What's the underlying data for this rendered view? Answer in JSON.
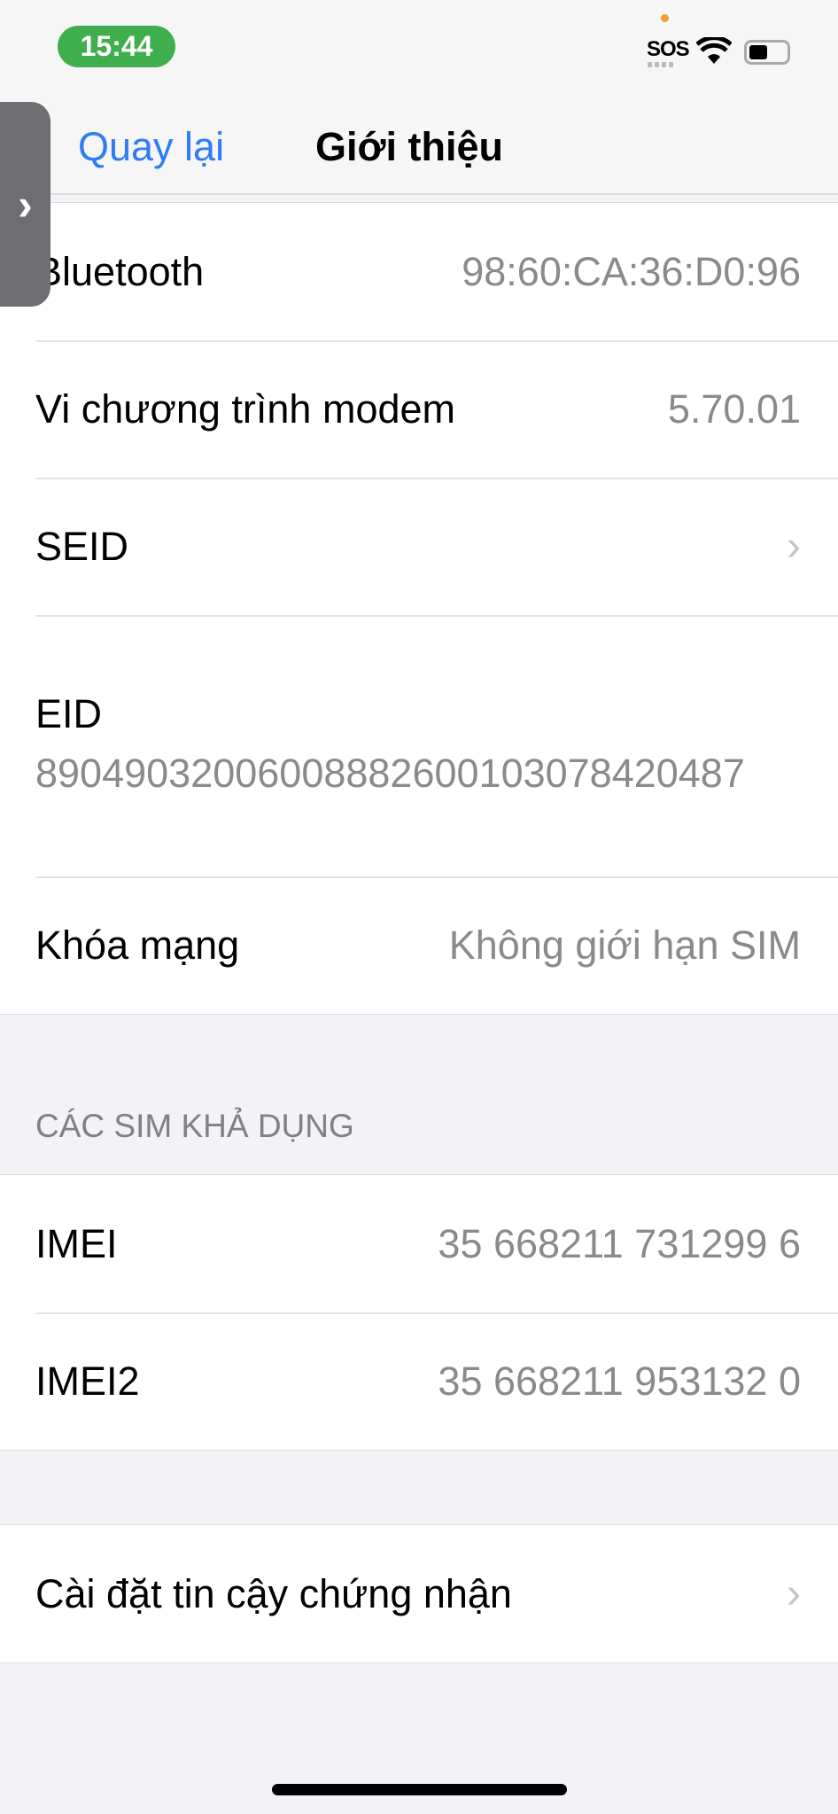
{
  "status_bar": {
    "time": "15:44",
    "carrier": "SOS",
    "wifi_icon": "wifi-icon",
    "battery_icon": "battery-icon"
  },
  "nav": {
    "back_label": "Quay lại",
    "title": "Giới thiệu"
  },
  "overlay_tab_icon": "chevron-right-icon",
  "rows": [
    {
      "label": "Bluetooth",
      "value": "98:60:CA:36:D0:96"
    },
    {
      "label": "Vi chương trình modem",
      "value": "5.70.01"
    },
    {
      "label": "SEID"
    },
    {
      "label": "EID",
      "value": "89049032006008882600103078420487"
    },
    {
      "label": "Khóa mạng",
      "value": "Không giới hạn SIM"
    }
  ],
  "sim_section": {
    "header": "CÁC SIM KHẢ DỤNG",
    "rows": [
      {
        "label": "IMEI",
        "value": "35 668211 731299 6"
      },
      {
        "label": "IMEI2",
        "value": "35 668211 953132 0"
      }
    ]
  },
  "cert_row": {
    "label": "Cài đặt tin cậy chứng nhận"
  },
  "colors": {
    "accent": "#2f7cf6",
    "time_pill": "#3fae4c",
    "background": "#f2f2f7"
  }
}
